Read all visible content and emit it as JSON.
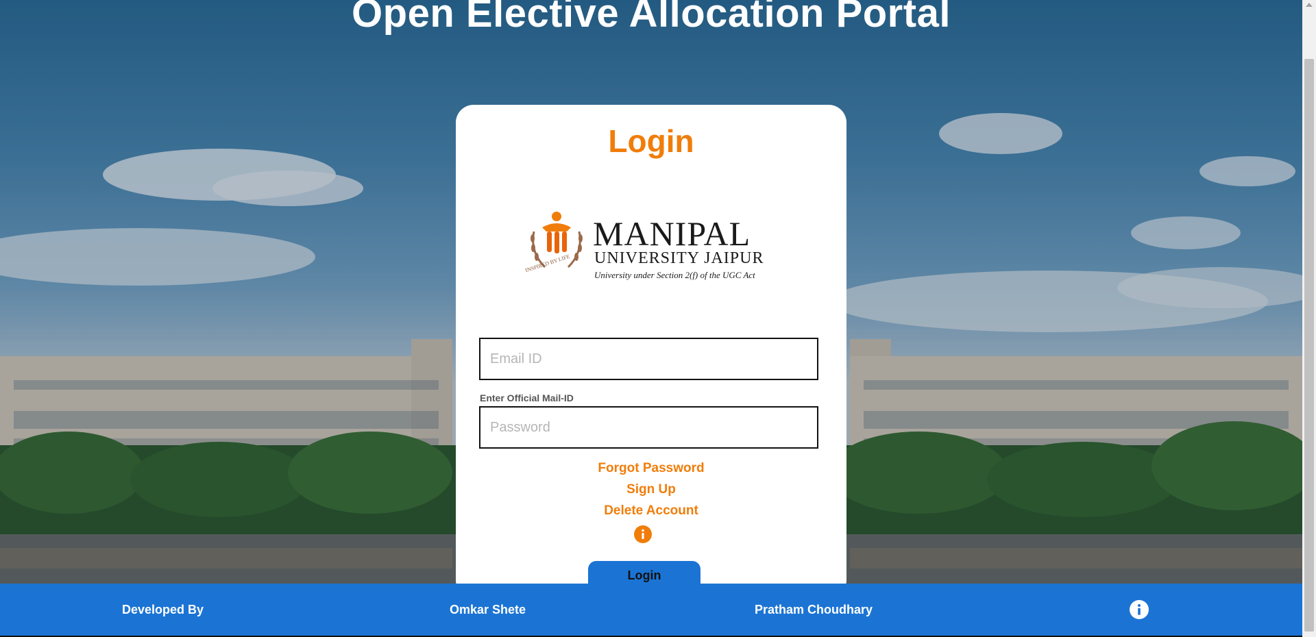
{
  "page": {
    "title": "Open Elective Allocation Portal"
  },
  "login_card": {
    "heading": "Login",
    "logo": {
      "name": "MANIPAL",
      "subtitle": "UNIVERSITY JAIPUR",
      "tagline": "University under Section 2(f) of the UGC Act",
      "motto": "INSPIRED BY LIFE"
    },
    "email": {
      "placeholder": "Email ID",
      "value": "",
      "helper": "Enter Official Mail-ID"
    },
    "password": {
      "placeholder": "Password",
      "value": ""
    },
    "links": {
      "forgot": "Forgot Password",
      "signup": "Sign Up",
      "delete": "Delete Account"
    },
    "info_icon": "info-icon",
    "login_button": "Login"
  },
  "footer": {
    "developed_by": "Developed By",
    "dev1": "Omkar Shete",
    "dev2": "Pratham Choudhary",
    "info_icon": "info-icon"
  },
  "colors": {
    "accent_orange": "#f07d0a",
    "primary_blue": "#1b74d4",
    "card_bg": "#ffffff"
  }
}
